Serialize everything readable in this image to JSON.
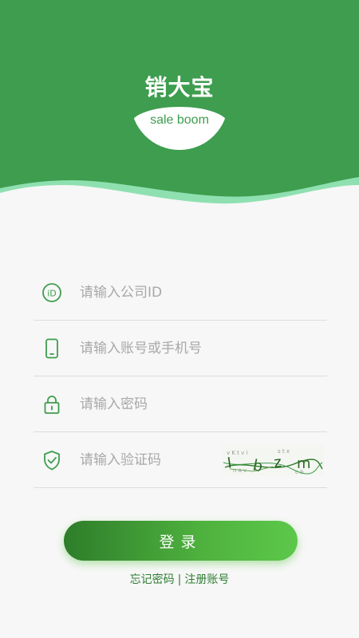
{
  "header": {
    "logo_brand": "销大宝",
    "logo_sub": "sale boom",
    "colors": {
      "primary": "#3e9d4e",
      "wave": "#8fe0b0"
    }
  },
  "form": {
    "company_id": {
      "placeholder": "请输入公司ID",
      "value": "",
      "icon": "id-icon"
    },
    "account": {
      "placeholder": "请输入账号或手机号",
      "value": "",
      "icon": "phone-icon"
    },
    "password": {
      "placeholder": "请输入密码",
      "value": "",
      "icon": "lock-icon"
    },
    "captcha": {
      "placeholder": "请输入验证码",
      "value": "",
      "icon": "shield-check-icon",
      "image_text": "l b z m"
    }
  },
  "login_button": {
    "label": "登录"
  },
  "links": {
    "forgot": "忘记密码",
    "separator": "|",
    "register": "注册账号"
  }
}
